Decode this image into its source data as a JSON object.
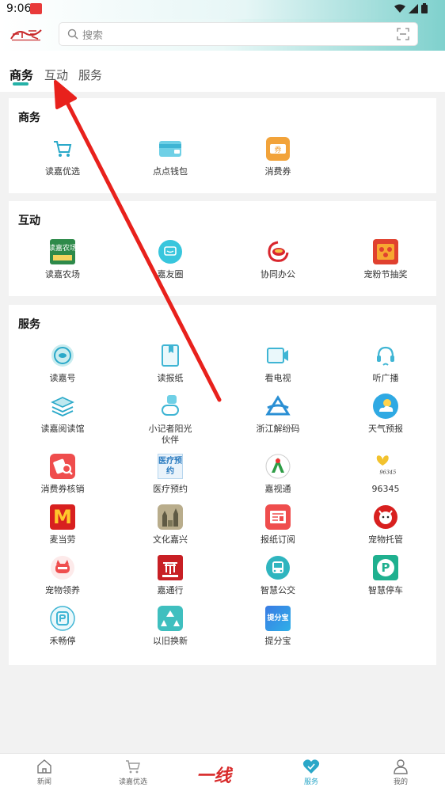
{
  "status_bar": {
    "time": "9:06"
  },
  "header": {
    "search_placeholder": "搜索"
  },
  "tabs": [
    {
      "label": "商务"
    },
    {
      "label": "互动"
    },
    {
      "label": "服务"
    }
  ],
  "sections": {
    "business": {
      "title": "商务",
      "items": [
        {
          "label": "读嘉优选",
          "icon": "shopping-cart-icon"
        },
        {
          "label": "点点钱包",
          "icon": "wallet-icon"
        },
        {
          "label": "消费券",
          "icon": "coupon-icon"
        }
      ]
    },
    "interaction": {
      "title": "互动",
      "items": [
        {
          "label": "读嘉农场",
          "icon": "farm-icon",
          "icon_text": "读嘉农场"
        },
        {
          "label": "嘉友圈",
          "icon": "chat-circle-icon"
        },
        {
          "label": "协同办公",
          "icon": "office-icon"
        },
        {
          "label": "宠粉节抽奖",
          "icon": "lottery-icon"
        }
      ]
    },
    "services": {
      "title": "服务",
      "items": [
        {
          "label": "读嘉号",
          "icon": "account-icon"
        },
        {
          "label": "读报纸",
          "icon": "newspaper-icon"
        },
        {
          "label": "看电视",
          "icon": "tv-icon"
        },
        {
          "label": "听广播",
          "icon": "radio-icon"
        },
        {
          "label": "读嘉阅读馆",
          "icon": "reading-icon"
        },
        {
          "label": "小记者阳光伙伴",
          "icon": "reporter-icon"
        },
        {
          "label": "浙江解纷码",
          "icon": "dispute-code-icon"
        },
        {
          "label": "天气预报",
          "icon": "weather-icon"
        },
        {
          "label": "消费券核销",
          "icon": "coupon-verify-icon"
        },
        {
          "label": "医疗预约",
          "icon": "medical-icon",
          "icon_text": "医疗预约"
        },
        {
          "label": "嘉视通",
          "icon": "jiashitong-icon"
        },
        {
          "label": "96345",
          "icon": "hotline-icon",
          "icon_text": "96345"
        },
        {
          "label": "麦当劳",
          "icon": "mcdonalds-icon",
          "icon_text": "M"
        },
        {
          "label": "文化嘉兴",
          "icon": "culture-icon"
        },
        {
          "label": "报纸订阅",
          "icon": "subscription-icon"
        },
        {
          "label": "宠物托管",
          "icon": "pet-care-icon"
        },
        {
          "label": "宠物领养",
          "icon": "pet-adopt-icon"
        },
        {
          "label": "嘉通行",
          "icon": "transit-icon"
        },
        {
          "label": "智慧公交",
          "icon": "bus-icon"
        },
        {
          "label": "智慧停车",
          "icon": "parking-icon",
          "icon_text": "P"
        },
        {
          "label": "禾畅停",
          "icon": "heting-icon"
        },
        {
          "label": "以旧换新",
          "icon": "recycle-icon"
        },
        {
          "label": "提分宝",
          "icon": "tifenbao-icon",
          "icon_text": "提分宝"
        }
      ]
    }
  },
  "bottom_nav": {
    "items": [
      {
        "label": "新闻"
      },
      {
        "label": "读嘉优选"
      },
      {
        "label": "服务"
      },
      {
        "label": "我的"
      }
    ],
    "center_logo": "一线"
  },
  "colors": {
    "accent": "#25b1a7",
    "annotation": "#e8211c"
  }
}
